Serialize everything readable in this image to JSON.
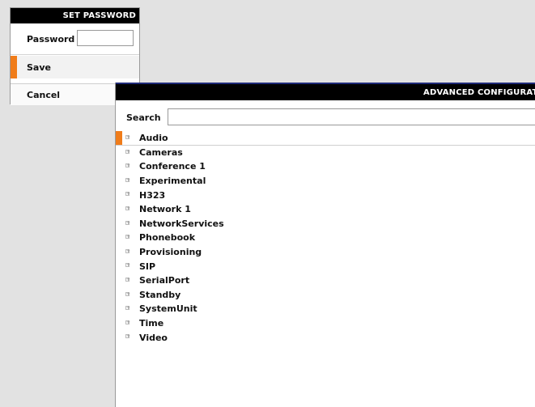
{
  "set_password": {
    "title": "SET PASSWORD",
    "password_label": "Password",
    "password_value": "",
    "save_label": "Save",
    "cancel_label": "Cancel"
  },
  "advanced": {
    "title": "ADVANCED CONFIGURATIO",
    "search_label": "Search",
    "search_value": "",
    "items": [
      {
        "label": "Audio"
      },
      {
        "label": "Cameras"
      },
      {
        "label": "Conference 1"
      },
      {
        "label": "Experimental"
      },
      {
        "label": "H323"
      },
      {
        "label": "Network 1"
      },
      {
        "label": "NetworkServices"
      },
      {
        "label": "Phonebook"
      },
      {
        "label": "Provisioning"
      },
      {
        "label": "SIP"
      },
      {
        "label": "SerialPort"
      },
      {
        "label": "Standby"
      },
      {
        "label": "SystemUnit"
      },
      {
        "label": "Time"
      },
      {
        "label": "Video"
      }
    ],
    "selected_index": 0
  },
  "colors": {
    "accent": "#f07c1a",
    "title_bar": "#000000",
    "background": "#e2e2e2"
  },
  "icons": {
    "tree_expander": "expand-square-icon"
  }
}
